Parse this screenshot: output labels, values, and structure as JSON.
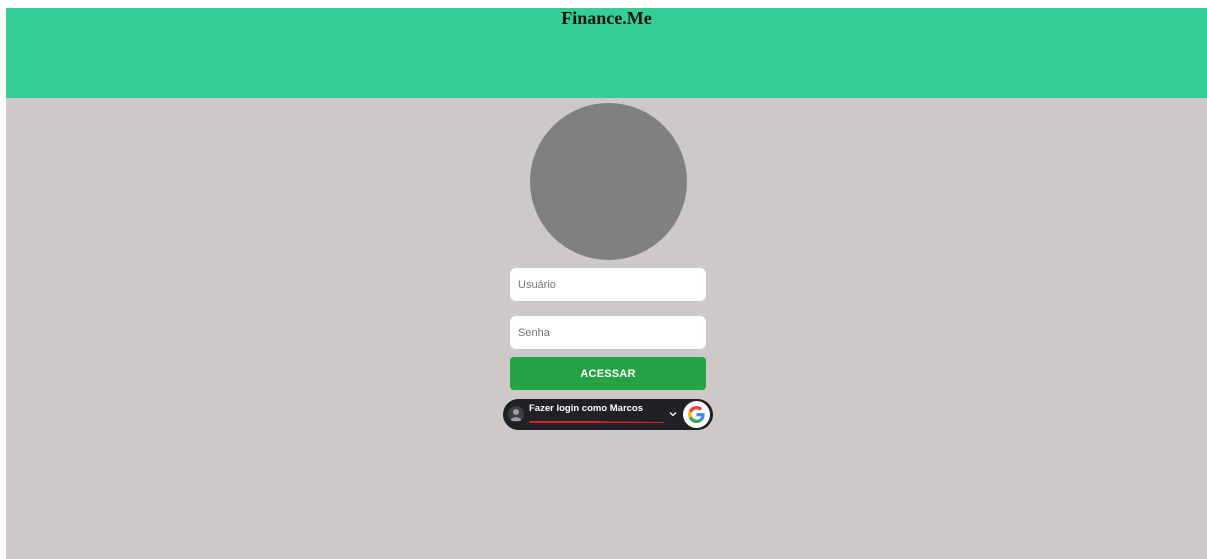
{
  "header": {
    "title": "Finance.Me"
  },
  "login": {
    "username_placeholder": "Usuário",
    "password_placeholder": "Senha",
    "submit_label": "ACESSAR"
  },
  "google_signin": {
    "label": "Fazer login como Marcos",
    "account_email": "",
    "icons": [
      "account-avatar-icon",
      "chevron-down-icon",
      "google-g-icon"
    ]
  },
  "colors": {
    "header_bg": "#34ce96",
    "page_bg": "#cdc9c8",
    "avatar_placeholder": "#808080",
    "submit_bg": "#26a244",
    "google_button_bg": "#202124",
    "redaction": "#e0221e"
  }
}
